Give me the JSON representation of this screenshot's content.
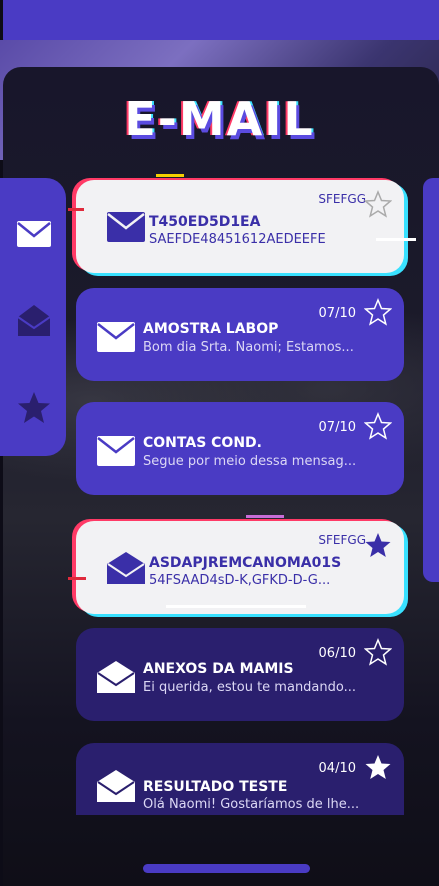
{
  "app": {
    "title": "E-MAIL"
  },
  "colors": {
    "primary": "#4a3bc4",
    "dark_card": "#2a1f6e",
    "glitch_card": "#f2f2f4",
    "white": "#ffffff"
  },
  "sidebar": {
    "items": [
      {
        "icon": "envelope-icon",
        "label": ""
      },
      {
        "icon": "open-envelope-icon",
        "label": ""
      },
      {
        "icon": "star-icon",
        "label": ""
      }
    ]
  },
  "emails": [
    {
      "sender": "T450ED5D1EA",
      "preview": "SAEFDE48451612AEDEEFE",
      "date": "SFEFGG",
      "starred": false,
      "style": "glitch",
      "icon": "envelope-icon"
    },
    {
      "sender": "AMOSTRA LABOP",
      "preview": "Bom dia Srta. Naomi; Estamos...",
      "date": "07/10",
      "starred": false,
      "style": "purple",
      "icon": "envelope-icon"
    },
    {
      "sender": "CONTAS COND.",
      "preview": "Segue por meio dessa mensag...",
      "date": "07/10",
      "starred": false,
      "style": "purple",
      "icon": "envelope-icon"
    },
    {
      "sender": "ASDAPJREMCANOMA01S",
      "preview": "54FSAAD4sD-K,GFKD-D-G...",
      "date": "SFEFGG",
      "starred": true,
      "style": "glitch",
      "icon": "open-envelope-icon"
    },
    {
      "sender": "ANEXOS DA MAMIS",
      "preview": "Ei querida, estou te mandando...",
      "date": "06/10",
      "starred": false,
      "style": "dark",
      "icon": "open-envelope-icon"
    },
    {
      "sender": "RESULTADO TESTE",
      "preview": "Olá Naomi! Gostaríamos de lhe...",
      "date": "04/10",
      "starred": true,
      "style": "dark",
      "icon": "open-envelope-icon"
    }
  ]
}
